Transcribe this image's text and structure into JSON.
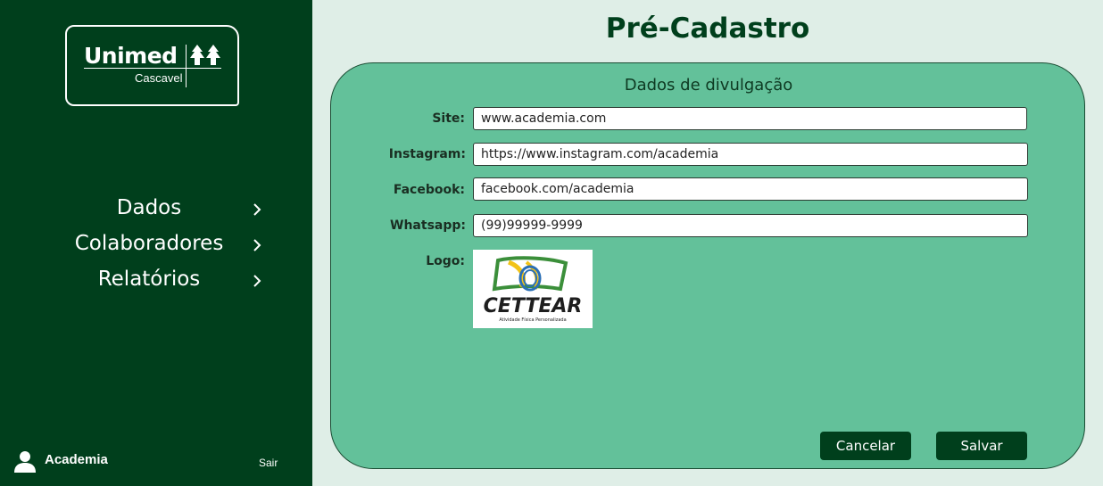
{
  "sidebar": {
    "logo": {
      "brand": "Unimed",
      "city": "Cascavel"
    },
    "nav": [
      {
        "label": "Dados",
        "icon": "chevron-right-icon"
      },
      {
        "label": "Colaboradores",
        "icon": "chevron-right-icon"
      },
      {
        "label": "Relatórios",
        "icon": "chevron-right-icon"
      }
    ],
    "user": {
      "name": "Academia",
      "icon": "user-icon"
    },
    "logout_label": "Sair"
  },
  "main": {
    "title": "Pré-Cadastro",
    "section_title": "Dados de divulgação",
    "fields": {
      "site": {
        "label": "Site:",
        "value": "www.academia.com"
      },
      "instagram": {
        "label": "Instagram:",
        "value": "https://www.instagram.com/academia"
      },
      "facebook": {
        "label": "Facebook:",
        "value": "facebook.com/academia"
      },
      "whatsapp": {
        "label": "Whatsapp:",
        "value": "(99)99999-9999"
      }
    },
    "logo": {
      "label": "Logo:",
      "brand_text": "CETTEAR",
      "tagline": "Atividade Física Personalizada"
    },
    "buttons": {
      "cancel": "Cancelar",
      "save": "Salvar"
    }
  },
  "colors": {
    "sidebar_bg": "#003f1c",
    "page_bg": "#dfeee7",
    "panel_bg": "#63c19a",
    "button_bg": "#003f1c"
  }
}
